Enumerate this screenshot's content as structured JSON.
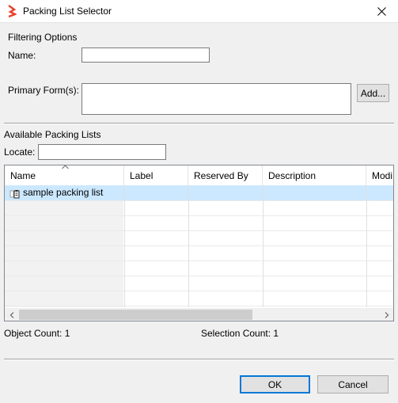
{
  "window": {
    "title": "Packing List Selector",
    "icons": {
      "app": "brand-logo-icon",
      "close": "close-icon"
    },
    "accent_color": "#e8412c"
  },
  "filtering": {
    "section_label": "Filtering Options",
    "name_label": "Name:",
    "name_value": "",
    "primary_forms_label": "Primary Form(s):",
    "primary_forms_value": "",
    "add_button": "Add..."
  },
  "available": {
    "section_label": "Available Packing Lists",
    "locate_label": "Locate:",
    "locate_value": ""
  },
  "table": {
    "columns": [
      "Name",
      "Label",
      "Reserved By",
      "Description",
      "Modi"
    ],
    "sort_column": "Name",
    "rows": [
      {
        "name": "sample packing list",
        "label": "",
        "reserved_by": "",
        "description": "",
        "modified": "",
        "icon": "packing-list-icon",
        "selected": true
      }
    ],
    "selection_color": "#cce8ff"
  },
  "status": {
    "object_count": "Object Count: 1",
    "selection_count": "Selection Count: 1"
  },
  "buttons": {
    "ok": "OK",
    "cancel": "Cancel"
  }
}
